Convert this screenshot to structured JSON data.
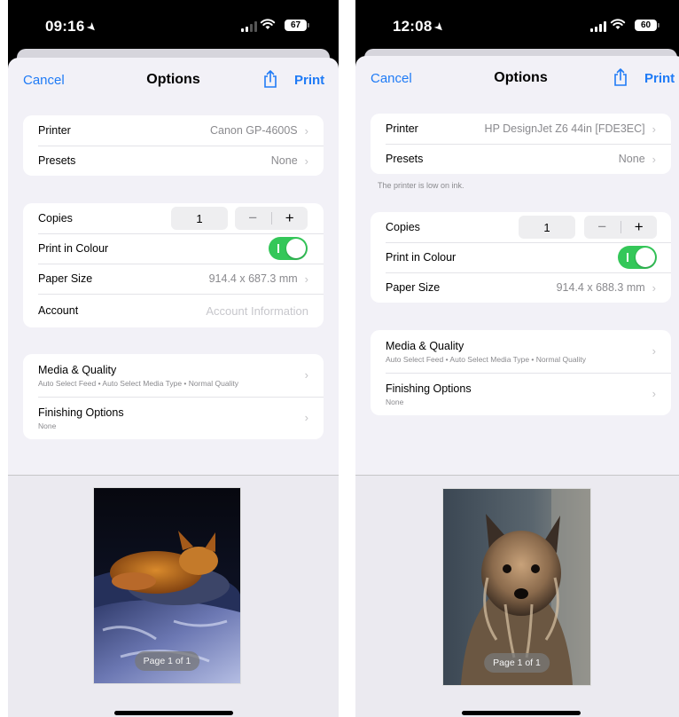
{
  "left": {
    "status": {
      "time": "09:16",
      "battery": "67"
    },
    "nav": {
      "cancel": "Cancel",
      "title": "Options",
      "print": "Print"
    },
    "printer": {
      "label": "Printer",
      "value": "Canon GP-4600S"
    },
    "presets": {
      "label": "Presets",
      "value": "None"
    },
    "copies": {
      "label": "Copies",
      "value": "1"
    },
    "colour": {
      "label": "Print in Colour",
      "on": true
    },
    "paper": {
      "label": "Paper Size",
      "value": "914.4 x 687.3 mm"
    },
    "account": {
      "label": "Account",
      "placeholder": "Account Information"
    },
    "media": {
      "title": "Media & Quality",
      "subtitle": "Auto Select Feed • Auto Select Media Type • Normal Quality"
    },
    "finishing": {
      "title": "Finishing Options",
      "subtitle": "None"
    },
    "preview": {
      "page": "Page 1 of 1"
    }
  },
  "right": {
    "status": {
      "time": "12:08",
      "battery": "60"
    },
    "nav": {
      "cancel": "Cancel",
      "title": "Options",
      "print": "Print"
    },
    "printer": {
      "label": "Printer",
      "value": "HP DesignJet Z6 44in [FDE3EC]"
    },
    "presets": {
      "label": "Presets",
      "value": "None"
    },
    "note": "The printer is low on ink.",
    "copies": {
      "label": "Copies",
      "value": "1"
    },
    "colour": {
      "label": "Print in Colour",
      "on": true
    },
    "paper": {
      "label": "Paper Size",
      "value": "914.4 x 688.3 mm"
    },
    "media": {
      "title": "Media & Quality",
      "subtitle": "Auto Select Feed • Auto Select Media Type • Normal Quality"
    },
    "finishing": {
      "title": "Finishing Options",
      "subtitle": "None"
    },
    "preview": {
      "page": "Page 1 of 1"
    }
  },
  "icons": {
    "location": "location-arrow-icon",
    "share": "share-icon",
    "chevron": "chevron-right-icon",
    "wifi": "wifi-icon",
    "signal": "cellular-signal-icon",
    "battery": "battery-icon"
  },
  "colors": {
    "accent": "#1f7bf6",
    "toggle_on": "#34c759",
    "background": "#f2f1f7"
  }
}
